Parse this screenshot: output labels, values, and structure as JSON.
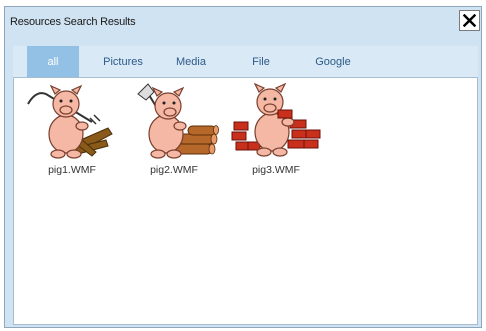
{
  "window": {
    "title": "Resources Search Results",
    "close_label": "X"
  },
  "tabs": [
    {
      "label": "all",
      "active": true
    },
    {
      "label": "Pictures",
      "active": false
    },
    {
      "label": "Media",
      "active": false
    },
    {
      "label": "File",
      "active": false
    },
    {
      "label": "Google",
      "active": false
    }
  ],
  "results": [
    {
      "name": "pig1.WMF",
      "icon": "pig-with-straw-icon"
    },
    {
      "name": "pig2.WMF",
      "icon": "pig-with-sticks-icon"
    },
    {
      "name": "pig3.WMF",
      "icon": "pig-with-bricks-icon"
    }
  ],
  "colors": {
    "window_bg": "#cfe3f3",
    "tab_active": "#93c1e5",
    "tab_text": "#2d5a8a",
    "pig_pink": "#f4b8a4"
  }
}
